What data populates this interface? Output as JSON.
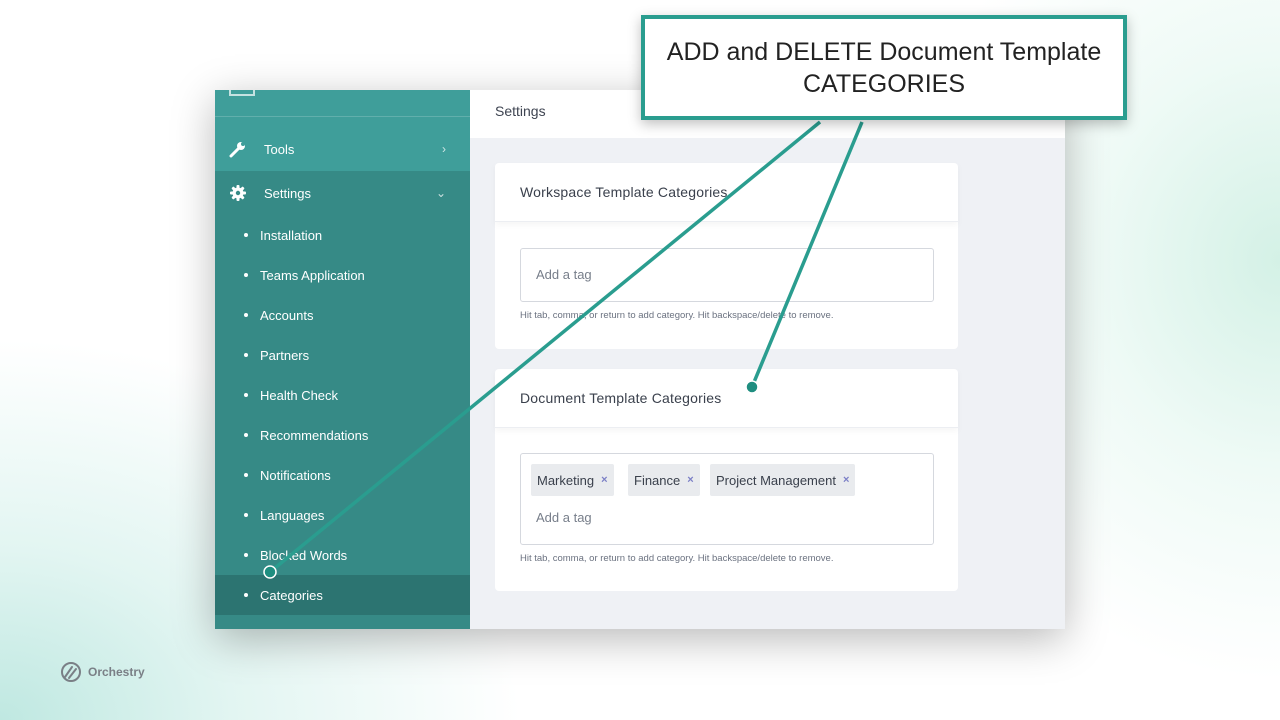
{
  "sidebar": {
    "tools": {
      "label": "Tools",
      "icon": "wrench-icon"
    },
    "settings": {
      "label": "Settings",
      "icon": "gear-icon"
    },
    "items": [
      {
        "label": "Installation"
      },
      {
        "label": "Teams Application"
      },
      {
        "label": "Accounts"
      },
      {
        "label": "Partners"
      },
      {
        "label": "Health Check"
      },
      {
        "label": "Recommendations"
      },
      {
        "label": "Notifications"
      },
      {
        "label": "Languages"
      },
      {
        "label": "Blocked Words"
      },
      {
        "label": "Categories",
        "active": true
      }
    ]
  },
  "header": {
    "title": "Settings"
  },
  "workspace_card": {
    "title": "Workspace Template Categories",
    "placeholder": "Add a tag",
    "hint": "Hit tab, comma, or return to add category. Hit backspace/delete to remove."
  },
  "document_card": {
    "title": "Document Template Categories",
    "tags": [
      {
        "label": "Marketing"
      },
      {
        "label": "Finance"
      },
      {
        "label": "Project Management"
      }
    ],
    "remove_symbol": "×",
    "placeholder": "Add a tag",
    "hint": "Hit tab, comma, or return to add category. Hit backspace/delete to remove."
  },
  "callout": {
    "line1": "ADD and DELETE Document Template",
    "line2": "CATEGORIES"
  },
  "brand": {
    "name": "Orchestry"
  },
  "colors": {
    "sidebar": "#368a86",
    "sidebar_top": "#3f9e9a",
    "active_item": "#2c7471",
    "accent": "#2a9d8f",
    "tag_x": "#7b7fc6"
  }
}
